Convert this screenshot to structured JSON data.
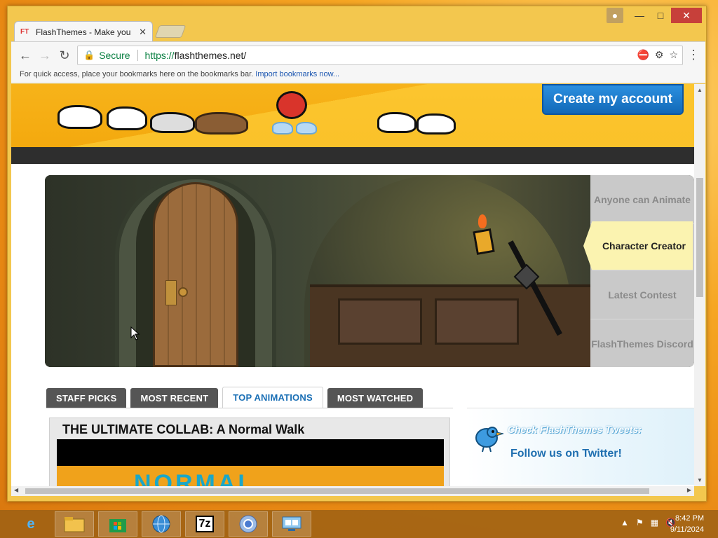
{
  "browser": {
    "tab_title": "FlashThemes - Make you",
    "tab_favicon_text": "FT",
    "address": {
      "secure_label": "Secure",
      "url_scheme": "https://",
      "url_rest": "flashthemes.net/"
    },
    "bookmarks_bar": {
      "message": "For quick access, place your bookmarks here on the bookmarks bar.",
      "link": "Import bookmarks now..."
    }
  },
  "site": {
    "create_account": "Create my account",
    "hero_menu": [
      {
        "label": "Anyone can Animate",
        "active": false
      },
      {
        "label": "Character Creator",
        "active": true
      },
      {
        "label": "Latest Contest",
        "active": false
      },
      {
        "label": "FlashThemes Discord",
        "active": false
      }
    ],
    "tabs": [
      {
        "label": "STAFF PICKS",
        "active": false
      },
      {
        "label": "MOST RECENT",
        "active": false
      },
      {
        "label": "TOP ANIMATIONS",
        "active": true
      },
      {
        "label": "MOST WATCHED",
        "active": false
      }
    ],
    "featured": {
      "title": "THE ULTIMATE COLLAB: A Normal Walk",
      "thumb_text": "NORMAL"
    },
    "twitter": {
      "heading": "Check FlashThemes Tweets:",
      "follow": "Follow us on Twitter!"
    }
  },
  "taskbar": {
    "clock_time": "8:42 PM",
    "clock_date": "9/11/2024",
    "pinned": [
      "internet-explorer-icon",
      "file-explorer-icon",
      "store-icon",
      "browser-globe-icon",
      "7zip-icon",
      "chrome-icon",
      "network-icon"
    ]
  },
  "colors": {
    "create_button": "#1b7ad0",
    "banner_orange": "#f4a90e",
    "active_tab_text": "#1a6fb5",
    "hero_active_bg": "#fbf3b0"
  }
}
